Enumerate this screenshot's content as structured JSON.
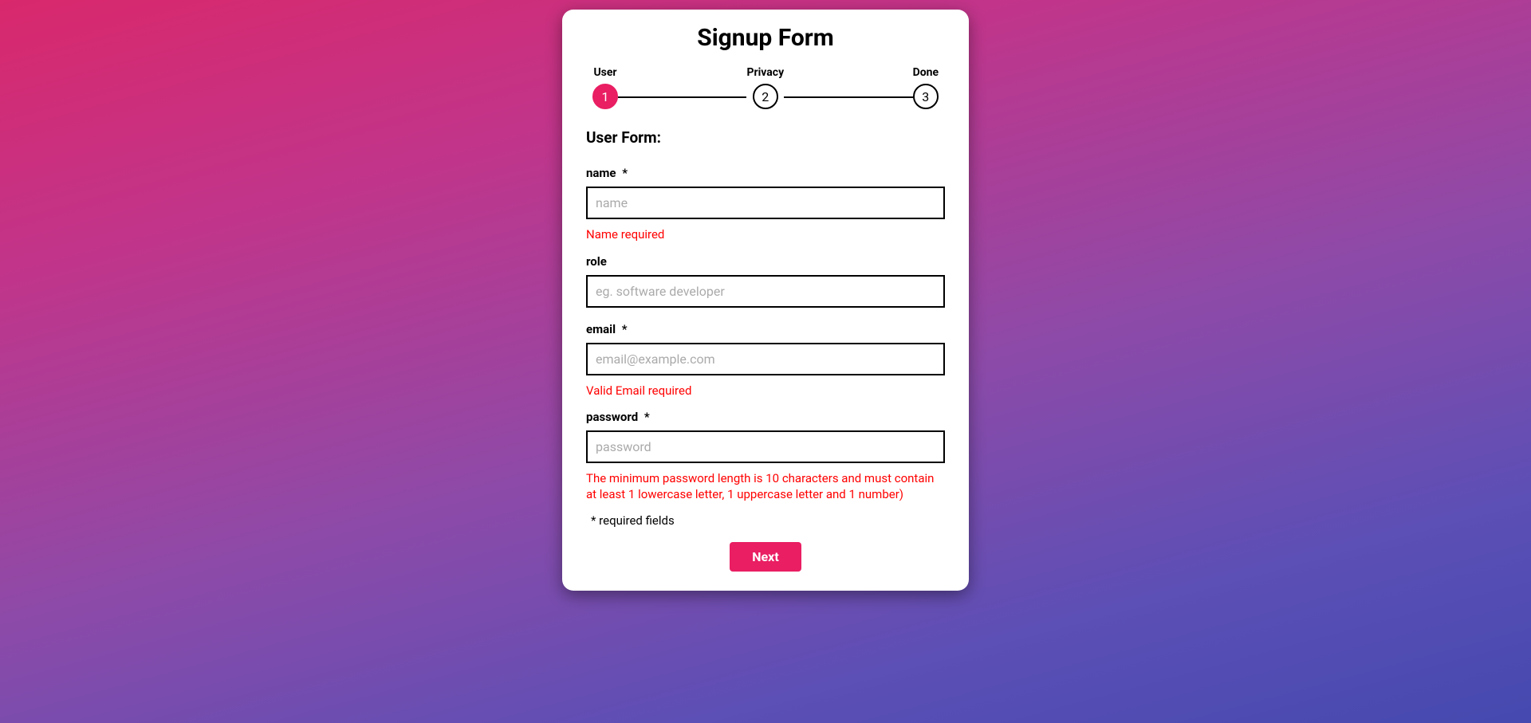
{
  "title": "Signup Form",
  "stepper": {
    "steps": [
      {
        "label": "User",
        "num": "1",
        "active": true
      },
      {
        "label": "Privacy",
        "num": "2",
        "active": false
      },
      {
        "label": "Done",
        "num": "3",
        "active": false
      }
    ]
  },
  "section_heading": "User Form:",
  "fields": {
    "name": {
      "label": "name",
      "required_mark": "*",
      "placeholder": "name",
      "error": "Name required"
    },
    "role": {
      "label": "role",
      "required_mark": "",
      "placeholder": "eg. software developer"
    },
    "email": {
      "label": "email",
      "required_mark": "*",
      "placeholder": "email@example.com",
      "error": "Valid Email required"
    },
    "password": {
      "label": "password",
      "required_mark": "*",
      "placeholder": "password",
      "error": "The minimum password length is 10 characters and must contain at least 1 lowercase letter, 1 uppercase letter and 1 number)"
    }
  },
  "footnote": "* required fields",
  "next_button": "Next"
}
